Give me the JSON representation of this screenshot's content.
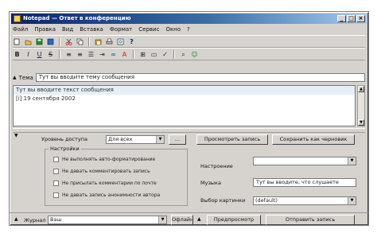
{
  "window": {
    "title": "Notepad — Ответ в конференцию",
    "controls": [
      "_",
      "□",
      "×"
    ]
  },
  "menu": [
    "Файл",
    "Правка",
    "Вид",
    "Вставка",
    "Формат",
    "Сервис",
    "Окно",
    "?"
  ],
  "toolbar1": [
    "new-icon",
    "open-icon",
    "save-icon",
    "save-as-icon",
    "cut-icon",
    "copy-icon",
    "paste-icon",
    "print-icon",
    "preview-icon",
    "help-icon"
  ],
  "toolbar2": [
    "bold-icon",
    "italic-icon",
    "underline-icon",
    "strike-icon",
    "align-left-icon",
    "align-center-icon",
    "align-right-icon",
    "list-icon",
    "indent-icon",
    "link-icon",
    "color-icon",
    "table-icon",
    "insert-icon",
    "spell-icon",
    "find-icon",
    "emoji-icon"
  ],
  "topic": {
    "label": "Тема",
    "value": "Тут вы вводите тему сообщения"
  },
  "editor": {
    "lines": [
      "Тут вы вводите текст сообщения",
      "",
      "[i] 19 сентября 2002"
    ]
  },
  "options": {
    "access_label": "Уровень доступа",
    "access_value": "Для всех",
    "settings_title": "Настройки",
    "checkboxes": [
      "Не выполнять авто-форматирование",
      "Не давать комментировать запись",
      "Не присылать комментарии по почте",
      "Не давать запись анонимности автора"
    ],
    "mood_label": "Настроение",
    "mood_value": "",
    "music_label": "Музыка",
    "music_value": "Тут вы вводите, что слушаете",
    "picture_label": "Выбор картинки",
    "picture_value": "(default)",
    "preview_button": "Просмотреть запись",
    "save_draft_button": "Сохранить как черновик",
    "ellipsis_button": "..."
  },
  "bottom": {
    "journal_label": "Журнал",
    "journal_value": "Ваш",
    "offline_button": "Офлайн",
    "prefs_button": "Предпросмотр",
    "send_button": "Отправить запись"
  },
  "colors": {
    "title_start": "#0a246a",
    "title_end": "#a6caf0",
    "face": "#d6d3ce"
  }
}
